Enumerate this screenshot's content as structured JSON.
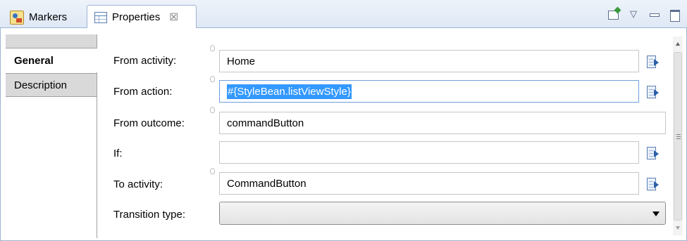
{
  "tabs": [
    {
      "label": "Markers",
      "icon": "markers-icon"
    },
    {
      "label": "Properties",
      "icon": "properties-icon",
      "close": "☒"
    }
  ],
  "side_tabs": {
    "general": "General",
    "description": "Description"
  },
  "form": {
    "from_activity": {
      "label": "From activity:",
      "value": "Home"
    },
    "from_action": {
      "label": "From action:",
      "value": "#{StyleBean.listViewStyle}"
    },
    "from_outcome": {
      "label": "From outcome:",
      "value": "commandButton"
    },
    "if": {
      "label": "If:",
      "value": ""
    },
    "to_activity": {
      "label": "To activity:",
      "value": "CommandButton"
    },
    "transition_type": {
      "label": "Transition type:",
      "value": ""
    }
  },
  "colors": {
    "tab_bar": "#dfe8f5",
    "selection": "#3399ff",
    "focus_border": "#6fa0dc"
  }
}
